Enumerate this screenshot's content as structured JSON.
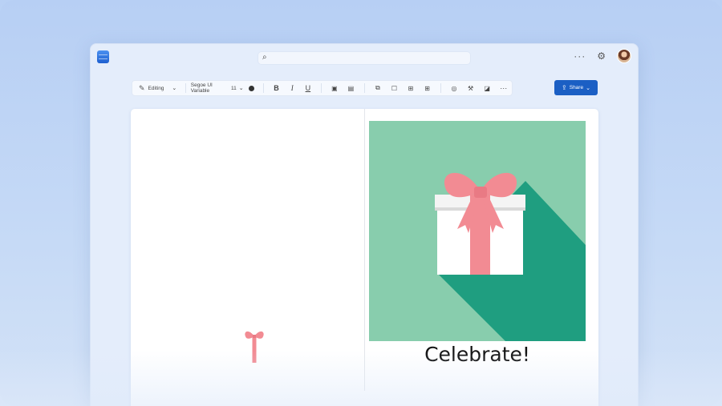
{
  "window": {
    "app_icon": "document-app-icon",
    "search": {
      "placeholder": "",
      "icon": "search-icon"
    },
    "more_icon": "more-horizontal-icon",
    "settings_icon": "gear-icon",
    "profile_icon": "avatar"
  },
  "toolbar": {
    "mode_label": "Editing",
    "font_name": "Segoe UI Variable",
    "font_size": "11",
    "text_color": "#333333",
    "bold_label": "B",
    "italic_label": "I",
    "underline_label": "U",
    "share_label": "Share"
  },
  "card": {
    "title": "Celebrate!",
    "colors": {
      "cover_background": "#88cdad",
      "cover_shadow": "#1f9e80",
      "box_white": "#ffffff",
      "ribbon_pink": "#f28b93"
    }
  }
}
